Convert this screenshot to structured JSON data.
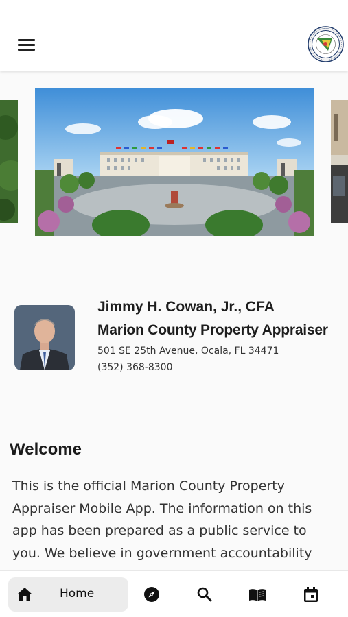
{
  "header": {
    "menu_icon": "hamburger-menu-icon",
    "seal_icon": "county-seal-logo"
  },
  "profile": {
    "name": "Jimmy H. Cowan, Jr., CFA",
    "title": "Marion County Property Appraiser",
    "address": "501 SE 25th Avenue, Ocala, FL 34471",
    "phone": "(352) 368-8300"
  },
  "welcome": {
    "heading": "Welcome",
    "body": "This is the official Marion County Property Appraiser Mobile App. The information on this app has been prepared as a public service to you. We believe in government accountability and in providing easy access to public data to the"
  },
  "bottom_nav": {
    "items": [
      {
        "label": "Home",
        "icon": "home-icon",
        "active": true
      },
      {
        "label": "",
        "icon": "compass-icon"
      },
      {
        "label": "",
        "icon": "search-icon"
      },
      {
        "label": "",
        "icon": "book-icon"
      },
      {
        "label": "",
        "icon": "calendar-icon"
      }
    ]
  },
  "colors": {
    "background": "#fafafa",
    "appbar": "#ffffff",
    "active_tab": "#ececec",
    "text": "#222222"
  }
}
